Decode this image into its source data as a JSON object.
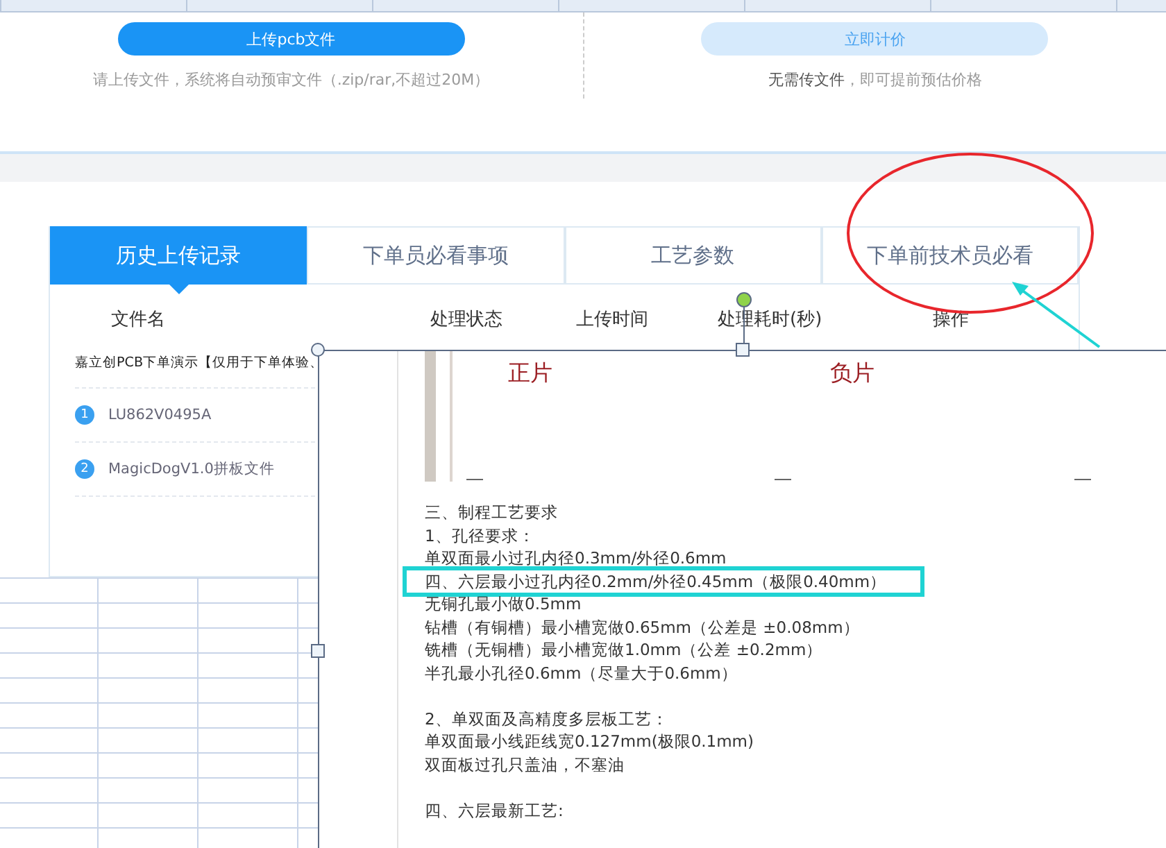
{
  "upload": {
    "left": {
      "button": "上传pcb文件",
      "hint": "请上传文件，系统将自动预审文件（.zip/rar,不超过20M）"
    },
    "right": {
      "button": "立即计价",
      "hint": "**无需传文件**，即可提前预估价格"
    }
  },
  "tabs": [
    {
      "label": "历史上传记录",
      "selected": true
    },
    {
      "label": "下单员必看事项",
      "selected": false
    },
    {
      "label": "工艺参数",
      "selected": false
    },
    {
      "label": "下单前技术员必看",
      "selected": false
    }
  ],
  "table": {
    "columns": [
      "文件名",
      "处理状态",
      "上传时间",
      "处理耗时(秒)",
      "操作"
    ],
    "rows": [
      {
        "name": "嘉立创PCB下单演示【仅用于下单体验、"
      },
      {
        "index": "1",
        "name": "LU862V0495A"
      },
      {
        "index": "2",
        "name": "MagicDogV1.0拼板文件"
      }
    ]
  },
  "pasted_document": {
    "image_labels": [
      "正片",
      "负片"
    ],
    "paragraphs": [
      {
        "lines": [
          {
            "text": "三、制程工艺要求",
            "highlighted": false
          },
          {
            "text": "1、孔径要求：",
            "highlighted": false
          },
          {
            "text": "单双面最小过孔内径0.3mm/外径0.6mm",
            "highlighted": false
          },
          {
            "text": "四、六层最小过孔内径0.2mm/外径0.45mm（极限0.40mm）",
            "highlighted": true
          },
          {
            "text": "无铜孔最小做0.5mm",
            "highlighted": false
          },
          {
            "text": "钻槽（有铜槽）最小槽宽做0.65mm（公差是 ±0.08mm）",
            "highlighted": false
          },
          {
            "text": "铣槽（无铜槽）最小槽宽做1.0mm（公差 ±0.2mm）",
            "highlighted": false
          },
          {
            "text": "半孔最小孔径0.6mm（尽量大于0.6mm）",
            "highlighted": false
          }
        ]
      },
      {
        "lines": [
          {
            "text": "2、单双面及高精度多层板工艺：",
            "highlighted": false
          },
          {
            "text": "单双面最小线距线宽0.127mm(极限0.1mm)",
            "highlighted": false
          },
          {
            "text": "双面板过孔只盖油，不塞油",
            "highlighted": false
          }
        ]
      },
      {
        "lines": [
          {
            "text": "四、六层最新工艺:",
            "highlighted": false
          }
        ]
      }
    ]
  }
}
